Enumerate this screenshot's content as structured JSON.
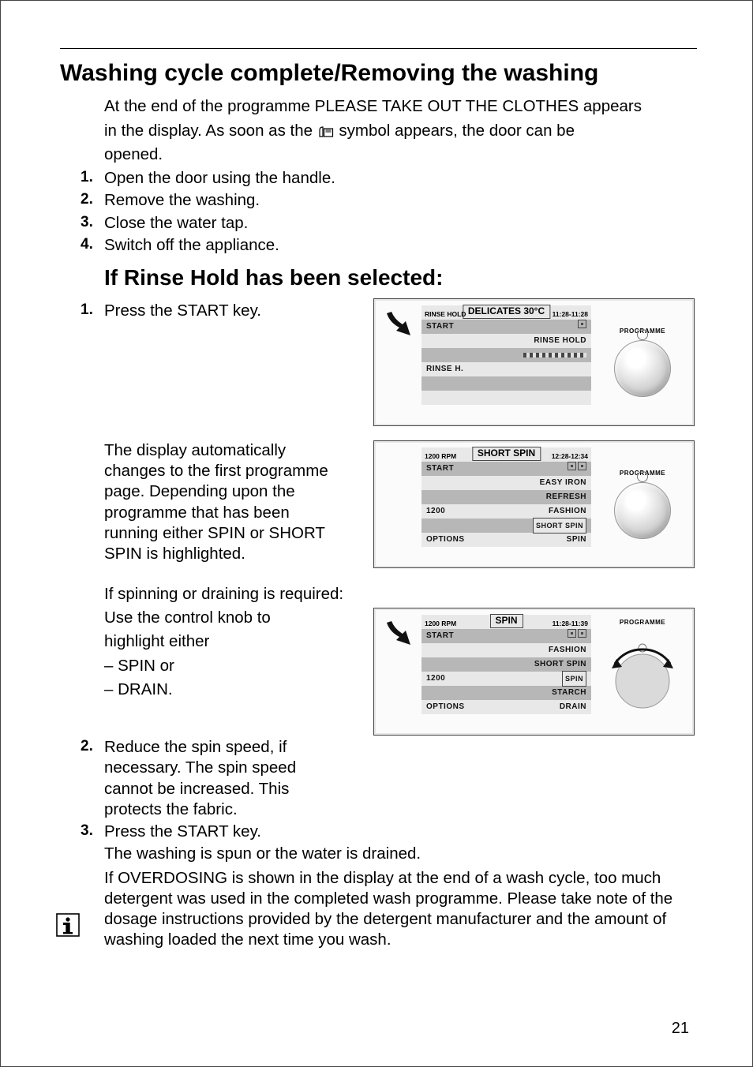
{
  "page_number": "21",
  "title": "Washing cycle complete/Removing the washing",
  "intro_line1": "At the end of the programme PLEASE TAKE OUT THE CLOTHES appears",
  "intro_line2_before": "in the display. As soon as the ",
  "intro_line2_after": " symbol appears, the door can be",
  "intro_line3": "opened.",
  "steps_initial": [
    "Open the door using the handle.",
    "Remove the washing.",
    "Close the water tap.",
    "Switch off the appliance."
  ],
  "rinse_hold_heading": "If Rinse Hold has been selected:",
  "rinse_step1": "Press the START key.",
  "auto_change_text": "The display automatically changes to the first programme page. Depending upon the programme that has been running either SPIN or SHORT SPIN is highlighted.",
  "spin_req_line": "If spinning or draining is required:",
  "use_knob_line1": "Use the control knob to",
  "use_knob_line2": "highlight either",
  "use_knob_opt1": "– SPIN or",
  "use_knob_opt2": "– DRAIN.",
  "step2": "Reduce the spin speed, if necessary. The spin speed cannot be increased. This protects the fabric.",
  "step3": "Press the START key.",
  "spun_drained": "The washing is spun or the water is drained.",
  "overdosing": "If OVERDOSING is shown in the display at the end of a wash cycle, too much detergent was used in the completed wash programme. Please take note of the dosage instructions provided by the detergent manufacturer and the amount of washing loaded the next time you wash.",
  "panels": {
    "programme_label": "PROGRAMME",
    "p1": {
      "title": "DELICATES 30°C",
      "sub_left": "RINSE HOLD",
      "sub_right": "11:28-11:28",
      "r1_left": "START",
      "r2_right": "RINSE HOLD",
      "r4_left": "RINSE H."
    },
    "p2": {
      "title": "SHORT SPIN",
      "sub_left": "1200 RPM",
      "sub_right": "12:28-12:34",
      "r1_left": "START",
      "r2_right": "EASY IRON",
      "r3_right": "REFRESH",
      "r4_left": "1200",
      "r4_right": "FASHION",
      "r5_right": "SHORT SPIN",
      "r6_left": "OPTIONS",
      "r6_right": "SPIN"
    },
    "p3": {
      "title": "SPIN",
      "sub_left": "1200 RPM",
      "sub_right": "11:28-11:39",
      "r1_left": "START",
      "r2_right": "FASHION",
      "r3_right": "SHORT SPIN",
      "r4_left": "1200",
      "r4_right": "SPIN",
      "r5_right": "STARCH",
      "r6_left": "OPTIONS",
      "r6_right": "DRAIN"
    }
  }
}
